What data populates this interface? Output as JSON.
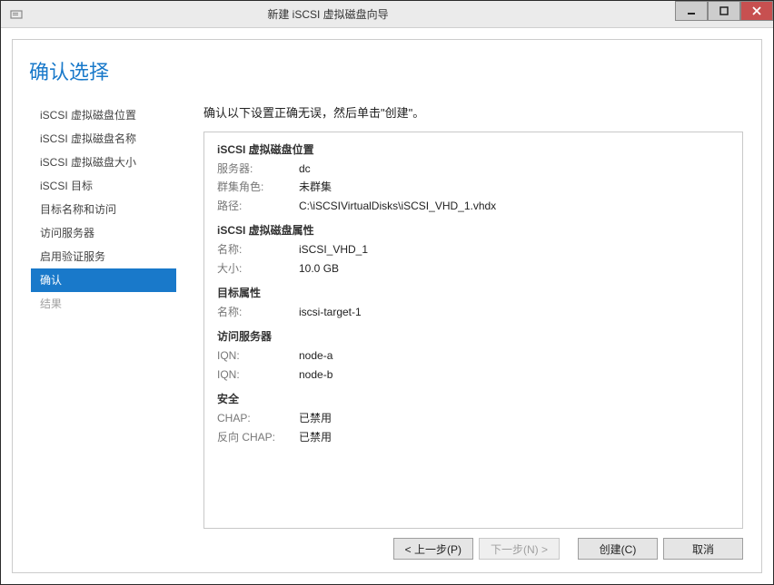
{
  "window": {
    "title": "新建 iSCSI 虚拟磁盘向导"
  },
  "heading": "确认选择",
  "sidebar": {
    "items": [
      {
        "label": "iSCSI 虚拟磁盘位置",
        "state": "normal"
      },
      {
        "label": "iSCSI 虚拟磁盘名称",
        "state": "normal"
      },
      {
        "label": "iSCSI 虚拟磁盘大小",
        "state": "normal"
      },
      {
        "label": "iSCSI 目标",
        "state": "normal"
      },
      {
        "label": "目标名称和访问",
        "state": "normal"
      },
      {
        "label": "访问服务器",
        "state": "normal"
      },
      {
        "label": "启用验证服务",
        "state": "normal"
      },
      {
        "label": "确认",
        "state": "active"
      },
      {
        "label": "结果",
        "state": "disabled"
      }
    ]
  },
  "instruction": "确认以下设置正确无误，然后单击\"创建\"。",
  "sections": {
    "location": {
      "title": "iSCSI 虚拟磁盘位置",
      "server_label": "服务器:",
      "server_value": "dc",
      "cluster_label": "群集角色:",
      "cluster_value": "未群集",
      "path_label": "路径:",
      "path_value": "C:\\iSCSIVirtualDisks\\iSCSI_VHD_1.vhdx"
    },
    "props": {
      "title": "iSCSI 虚拟磁盘属性",
      "name_label": "名称:",
      "name_value": "iSCSI_VHD_1",
      "size_label": "大小:",
      "size_value": "10.0 GB"
    },
    "target": {
      "title": "目标属性",
      "name_label": "名称:",
      "name_value": "iscsi-target-1"
    },
    "access": {
      "title": "访问服务器",
      "iqn1_label": "IQN:",
      "iqn1_value": "node-a",
      "iqn2_label": "IQN:",
      "iqn2_value": "node-b"
    },
    "security": {
      "title": "安全",
      "chap_label": "CHAP:",
      "chap_value": "已禁用",
      "rchap_label": "反向 CHAP:",
      "rchap_value": "已禁用"
    }
  },
  "footer": {
    "prev": "< 上一步(P)",
    "next": "下一步(N) >",
    "create": "创建(C)",
    "cancel": "取消"
  }
}
